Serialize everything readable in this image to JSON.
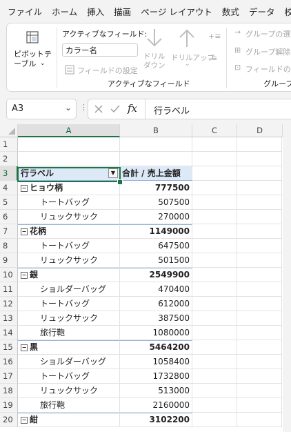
{
  "menu": [
    "ファイル",
    "ホーム",
    "挿入",
    "描画",
    "ページ レイアウト",
    "数式",
    "データ",
    "校"
  ],
  "ribbon": {
    "pivot_table_label": "ピボットテーブル",
    "active_field_title": "アクティブなフィールド:",
    "active_field_value": "カラー名",
    "field_settings": "フィールドの設定",
    "drill_down": "ドリル ダウン",
    "drill_up": "ドリルアップ",
    "group_label": "アクティブなフィールド",
    "group_selection": "グループの選",
    "ungroup": "グループ解除",
    "group_field": "フィールドのグ",
    "group_section_label": "グループ"
  },
  "formula_bar": {
    "name_box": "A3",
    "fx": "fx",
    "content": "行ラベル"
  },
  "columns": [
    "A",
    "B",
    "C",
    "D"
  ],
  "rows": [
    {
      "n": "1",
      "a": "",
      "b": "",
      "type": "empty"
    },
    {
      "n": "2",
      "a": "",
      "b": "",
      "type": "empty"
    },
    {
      "n": "3",
      "a": "行ラベル",
      "b": "合計 / 売上金額",
      "type": "header"
    },
    {
      "n": "4",
      "a": "ヒョウ柄",
      "b": "777500",
      "type": "group"
    },
    {
      "n": "5",
      "a": "トートバッグ",
      "b": "507500",
      "type": "item"
    },
    {
      "n": "6",
      "a": "リュックサック",
      "b": "270000",
      "type": "item"
    },
    {
      "n": "7",
      "a": "花柄",
      "b": "1149000",
      "type": "group"
    },
    {
      "n": "8",
      "a": "トートバッグ",
      "b": "647500",
      "type": "item"
    },
    {
      "n": "9",
      "a": "リュックサック",
      "b": "501500",
      "type": "item"
    },
    {
      "n": "10",
      "a": "銀",
      "b": "2549900",
      "type": "group"
    },
    {
      "n": "11",
      "a": "ショルダーバッグ",
      "b": "470400",
      "type": "item"
    },
    {
      "n": "12",
      "a": "トートバッグ",
      "b": "612000",
      "type": "item"
    },
    {
      "n": "13",
      "a": "リュックサック",
      "b": "387500",
      "type": "item"
    },
    {
      "n": "14",
      "a": "旅行鞄",
      "b": "1080000",
      "type": "item"
    },
    {
      "n": "15",
      "a": "黒",
      "b": "5464200",
      "type": "group"
    },
    {
      "n": "16",
      "a": "ショルダーバッグ",
      "b": "1058400",
      "type": "item"
    },
    {
      "n": "17",
      "a": "トートバッグ",
      "b": "1732800",
      "type": "item"
    },
    {
      "n": "18",
      "a": "リュックサック",
      "b": "513000",
      "type": "item"
    },
    {
      "n": "19",
      "a": "旅行鞄",
      "b": "2160000",
      "type": "item"
    },
    {
      "n": "20",
      "a": "紺",
      "b": "3102200",
      "type": "group"
    }
  ],
  "colors": {
    "accent": "#217346",
    "header_fill": "#dde9f7",
    "divider": "#95b3d7"
  }
}
